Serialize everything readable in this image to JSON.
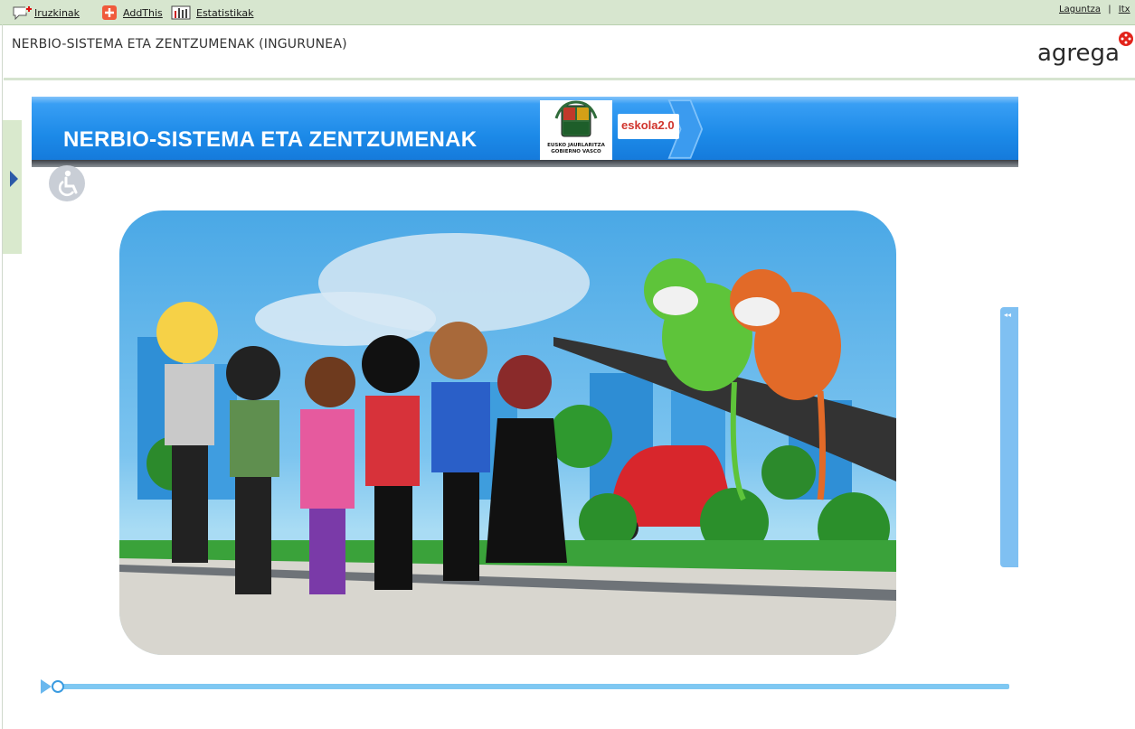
{
  "toolbar": {
    "comments_label": "Iruzkinak",
    "addthis_label": "AddThis",
    "stats_label": "Estatistikak",
    "help_label": "Laguntza",
    "separator": "|",
    "lang_label": "Itx"
  },
  "header": {
    "title": "NERBIO-SISTEMA ETA ZENTZUMENAK (INGURUNEA)",
    "logo_text": "agrega"
  },
  "banner": {
    "title": "NERBIO-SISTEMA ETA ZENTZUMENAK",
    "gov_line1": "EUSKO JAURLARITZA",
    "gov_line2": "GOBIERNO VASCO",
    "eskola_text": "eskola2.0"
  },
  "icons": {
    "comments": "comment-add-icon",
    "addthis": "plus-square-icon",
    "stats": "bar-chart-icon",
    "accessibility": "wheelchair-icon",
    "side": "chevron-right-icon",
    "play": "play-icon"
  },
  "colors": {
    "toolbar_bg": "#d7e6cf",
    "banner_blue": "#1c8ae8",
    "logo_red": "#e2231a",
    "progress": "#7fc8f2"
  },
  "player": {
    "progress_fraction": 0.0
  }
}
